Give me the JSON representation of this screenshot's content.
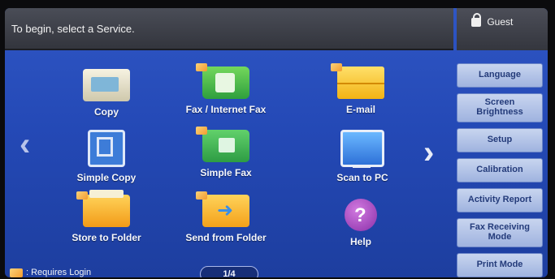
{
  "top_bar": {
    "instruction": "To begin, select a Service."
  },
  "user": {
    "name": "Guest"
  },
  "services": [
    {
      "label": "Copy"
    },
    {
      "label": "Fax / Internet Fax"
    },
    {
      "label": "E-mail"
    },
    {
      "label": "Simple Copy"
    },
    {
      "label": "Simple Fax"
    },
    {
      "label": "Scan to PC"
    },
    {
      "label": "Store to Folder"
    },
    {
      "label": "Send from Folder"
    },
    {
      "label": "Help"
    }
  ],
  "sidebar": {
    "items": [
      {
        "label": "Language"
      },
      {
        "label": "Screen Brightness"
      },
      {
        "label": "Setup"
      },
      {
        "label": "Calibration"
      },
      {
        "label": "Activity Report"
      },
      {
        "label": "Fax Receiving Mode"
      },
      {
        "label": "Print Mode"
      }
    ]
  },
  "footer": {
    "requires_login": ": Requires Login",
    "page_indicator": "1/4"
  },
  "icons": {
    "prev": "chevron-left-icon",
    "next": "chevron-right-icon"
  }
}
